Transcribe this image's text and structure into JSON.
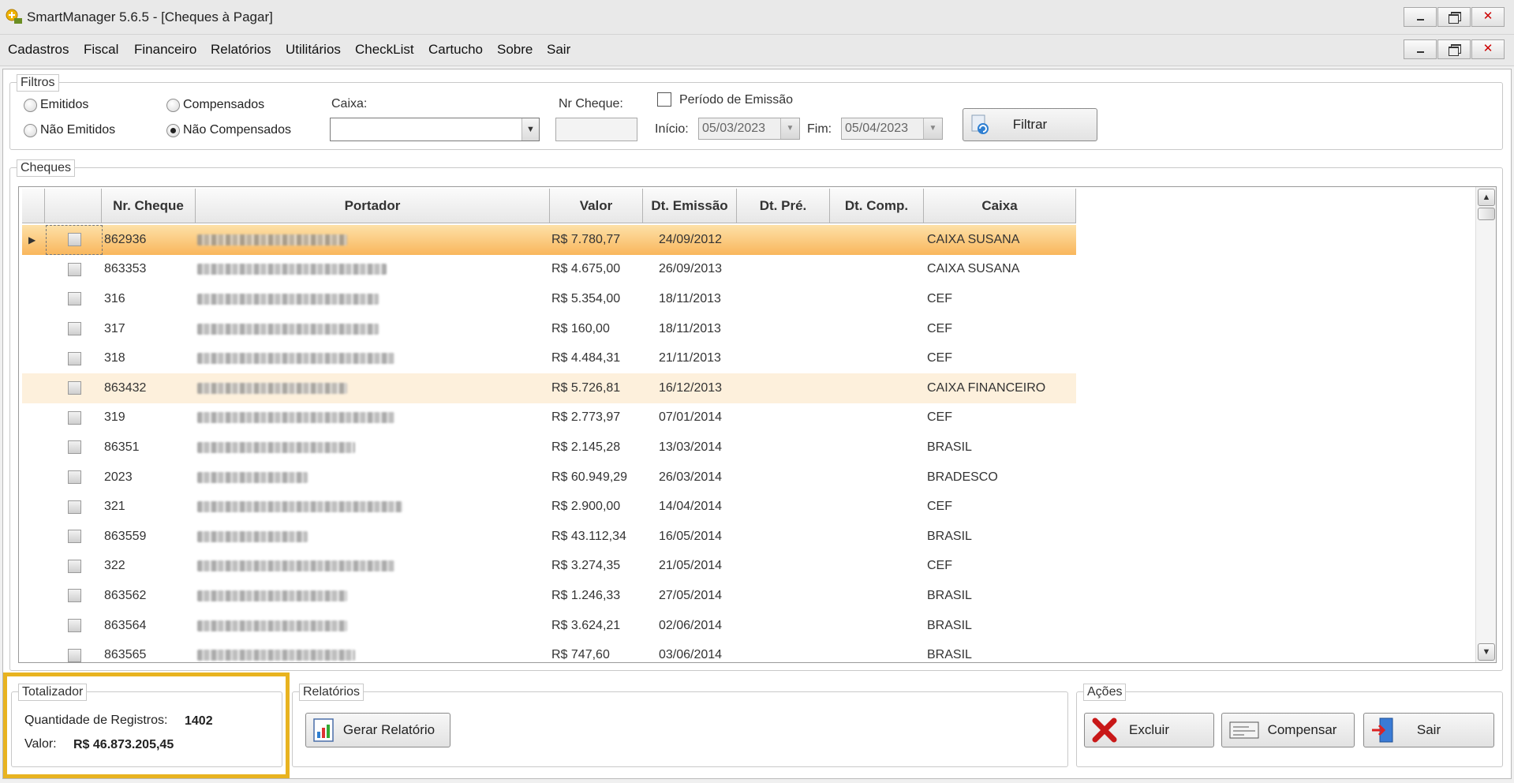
{
  "window": {
    "title": "SmartManager 5.6.5 - [Cheques à Pagar]"
  },
  "menu": [
    "Cadastros",
    "Fiscal",
    "Financeiro",
    "Relatórios",
    "Utilitários",
    "CheckList",
    "Cartucho",
    "Sobre",
    "Sair"
  ],
  "filters": {
    "legend": "Filtros",
    "radio_emitidos": "Emitidos",
    "radio_nao_emitidos": "Não Emitidos",
    "radio_compensados": "Compensados",
    "radio_nao_compensados": "Não Compensados",
    "caixa_label": "Caixa:",
    "caixa_value": "",
    "nr_cheque_label": "Nr Cheque:",
    "periodo_label": "Período de Emissão",
    "inicio_label": "Início:",
    "inicio_value": "05/03/2023",
    "fim_label": "Fim:",
    "fim_value": "05/04/2023",
    "filtrar_label": "Filtrar"
  },
  "cheques": {
    "legend": "Cheques",
    "columns": [
      "",
      "Nr. Cheque",
      "Portador",
      "Valor",
      "Dt. Emissão",
      "Dt. Pré.",
      "Dt. Comp.",
      "Caixa"
    ],
    "rows": [
      {
        "nr": "862936",
        "valor": "R$ 7.780,77",
        "emissao": "24/09/2012",
        "caixa": "CAIXA SUSANA"
      },
      {
        "nr": "863353",
        "valor": "R$ 4.675,00",
        "emissao": "26/09/2013",
        "caixa": "CAIXA SUSANA"
      },
      {
        "nr": "316",
        "valor": "R$ 5.354,00",
        "emissao": "18/11/2013",
        "caixa": "CEF"
      },
      {
        "nr": "317",
        "valor": "R$ 160,00",
        "emissao": "18/11/2013",
        "caixa": "CEF"
      },
      {
        "nr": "318",
        "valor": "R$ 4.484,31",
        "emissao": "21/11/2013",
        "caixa": "CEF"
      },
      {
        "nr": "863432",
        "valor": "R$ 5.726,81",
        "emissao": "16/12/2013",
        "caixa": "CAIXA FINANCEIRO"
      },
      {
        "nr": "319",
        "valor": "R$ 2.773,97",
        "emissao": "07/01/2014",
        "caixa": "CEF"
      },
      {
        "nr": "86351",
        "valor": "R$ 2.145,28",
        "emissao": "13/03/2014",
        "caixa": "BRASIL"
      },
      {
        "nr": "2023",
        "valor": "R$ 60.949,29",
        "emissao": "26/03/2014",
        "caixa": "BRADESCO"
      },
      {
        "nr": "321",
        "valor": "R$ 2.900,00",
        "emissao": "14/04/2014",
        "caixa": "CEF"
      },
      {
        "nr": "863559",
        "valor": "R$ 43.112,34",
        "emissao": "16/05/2014",
        "caixa": "BRASIL"
      },
      {
        "nr": "322",
        "valor": "R$ 3.274,35",
        "emissao": "21/05/2014",
        "caixa": "CEF"
      },
      {
        "nr": "863562",
        "valor": "R$ 1.246,33",
        "emissao": "27/05/2014",
        "caixa": "BRASIL"
      },
      {
        "nr": "863564",
        "valor": "R$ 3.624,21",
        "emissao": "02/06/2014",
        "caixa": "BRASIL"
      },
      {
        "nr": "863565",
        "valor": "R$ 747,60",
        "emissao": "03/06/2014",
        "caixa": "BRASIL"
      }
    ]
  },
  "totalizador": {
    "legend": "Totalizador",
    "qtd_label": "Quantidade de Registros:",
    "qtd_value": "1402",
    "valor_label": "Valor:",
    "valor_value": "R$ 46.873.205,45"
  },
  "relatorios": {
    "legend": "Relatórios",
    "gerar_label": "Gerar Relatório"
  },
  "acoes": {
    "legend": "Ações",
    "excluir_label": "Excluir",
    "compensar_label": "Compensar",
    "sair_label": "Sair"
  },
  "colors": {
    "selected_row": "#f9b65c",
    "alt_row": "#fdf0dc",
    "highlight": "#e8b320"
  }
}
